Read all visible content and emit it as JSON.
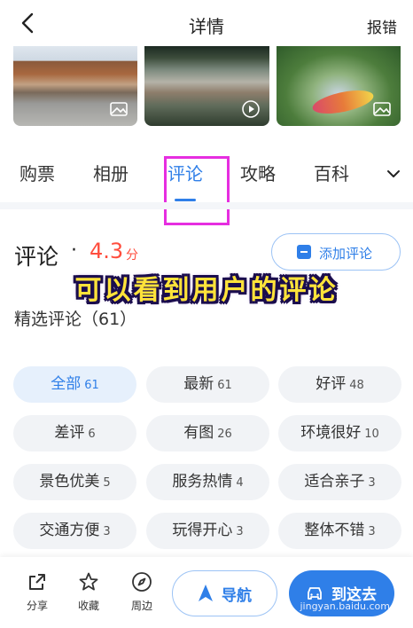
{
  "header": {
    "title": "详情",
    "report": "报错"
  },
  "tabs": [
    {
      "label": "购票"
    },
    {
      "label": "相册"
    },
    {
      "label": "评论",
      "active": true
    },
    {
      "label": "攻略"
    },
    {
      "label": "百科"
    }
  ],
  "reviews": {
    "title": "评论",
    "dot": "·",
    "score": "4.3",
    "score_unit": "分",
    "add_label": "添加评论",
    "selected_label": "精选评论（61）"
  },
  "overlay_caption": "可以看到用户的评论",
  "chips": [
    {
      "label": "全部",
      "count": "61",
      "active": true
    },
    {
      "label": "最新",
      "count": "61"
    },
    {
      "label": "好评",
      "count": "48"
    },
    {
      "label": "差评",
      "count": "6"
    },
    {
      "label": "有图",
      "count": "26"
    },
    {
      "label": "环境很好",
      "count": "10"
    },
    {
      "label": "景色优美",
      "count": "5"
    },
    {
      "label": "服务热情",
      "count": "4"
    },
    {
      "label": "适合亲子",
      "count": "3"
    },
    {
      "label": "交通方便",
      "count": "3"
    },
    {
      "label": "玩得开心",
      "count": "3"
    },
    {
      "label": "整体不错",
      "count": "3"
    }
  ],
  "bottom_bar": {
    "share": "分享",
    "favorite": "收藏",
    "nearby": "周边",
    "navigate": "导航",
    "go": "到这去",
    "watermark": "jingyan.baidu.com"
  },
  "colors": {
    "accent": "#2f7fe8",
    "score": "#ff4d3d",
    "highlight": "#e62ee0"
  }
}
